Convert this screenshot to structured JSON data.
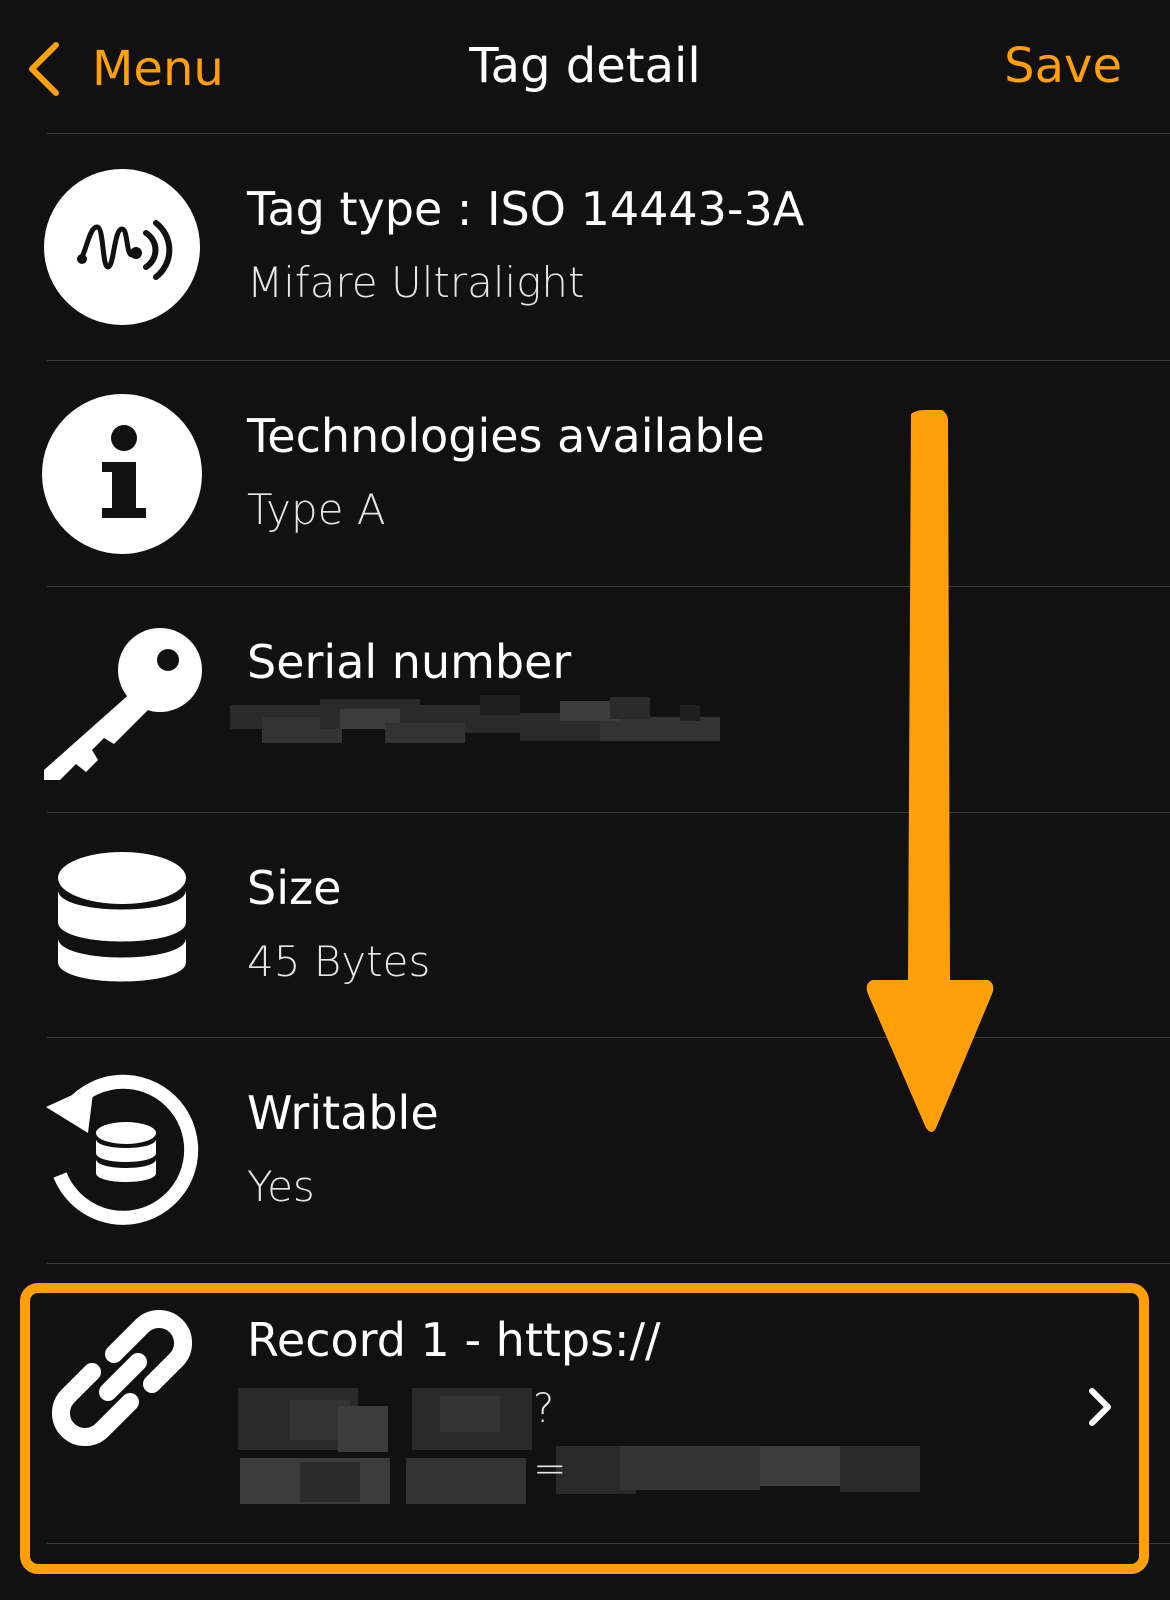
{
  "navbar": {
    "back_label": "Menu",
    "title": "Tag detail",
    "save_label": "Save"
  },
  "rows": [
    {
      "title": "Tag type : ISO 14443-3A",
      "subtitle": "Mifare Ultralight",
      "icon": "nfc-tag-icon"
    },
    {
      "title": "Technologies available",
      "subtitle": "Type A",
      "icon": "info-icon"
    },
    {
      "title": "Serial number",
      "subtitle": "",
      "icon": "key-icon"
    },
    {
      "title": "Size",
      "subtitle": "45 Bytes",
      "icon": "database-icon"
    },
    {
      "title": "Writable",
      "subtitle": "Yes",
      "icon": "writable-database-icon"
    },
    {
      "title": "Record 1 - https://",
      "subtitle_part1_end": "?",
      "subtitle_part2_mid": "=",
      "icon": "link-icon"
    }
  ],
  "colors": {
    "accent": "#FF9F0A",
    "background": "#111111",
    "divider": "#3a3a3a"
  }
}
